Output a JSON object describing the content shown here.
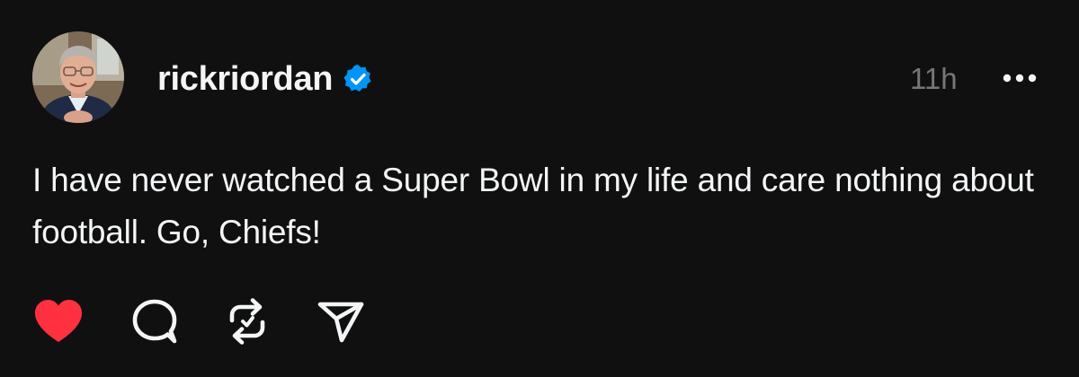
{
  "post": {
    "username": "rickriordan",
    "verified": true,
    "timestamp": "11h",
    "text": "I have never watched a Super Bowl in my life and care nothing about football. Go, Chiefs!"
  },
  "actions": {
    "like": {
      "icon": "heart-icon",
      "state": "liked"
    },
    "reply": {
      "icon": "comment-icon"
    },
    "repost": {
      "icon": "repost-icon"
    },
    "share": {
      "icon": "send-icon"
    }
  },
  "colors": {
    "background": "#101010",
    "text": "#f3f5f7",
    "muted": "#777777",
    "verified": "#0095f6",
    "liked": "#ff3040"
  }
}
